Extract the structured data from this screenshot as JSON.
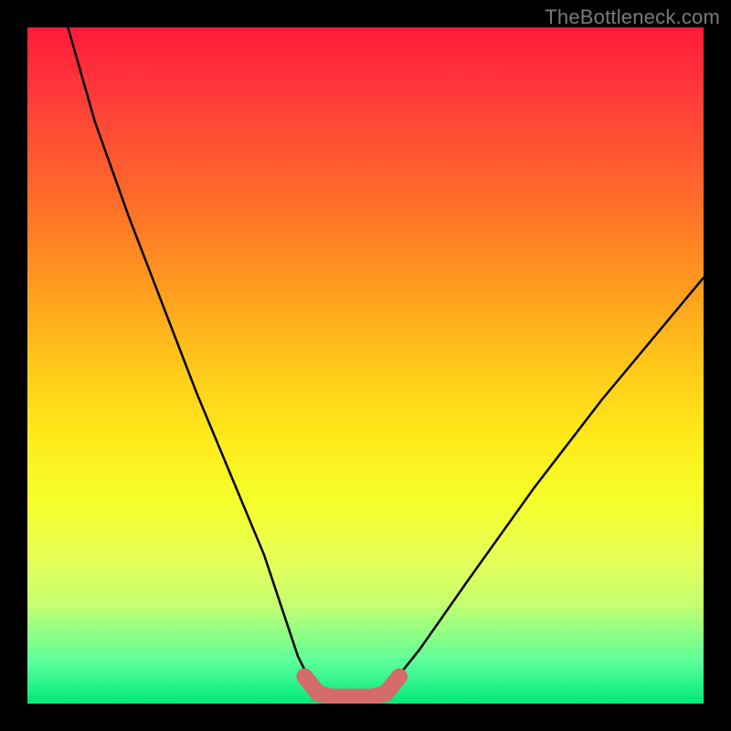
{
  "watermark": "TheBottleneck.com",
  "chart_data": {
    "type": "line",
    "title": "",
    "xlabel": "",
    "ylabel": "",
    "xlim": [
      0,
      100
    ],
    "ylim": [
      0,
      100
    ],
    "series": [
      {
        "name": "bottleneck-curve",
        "x": [
          6,
          10,
          15,
          20,
          25,
          30,
          35,
          38,
          40,
          42,
          44,
          46,
          48,
          50,
          52,
          54,
          58,
          65,
          75,
          85,
          95,
          100
        ],
        "values": [
          100,
          86,
          72,
          59,
          46,
          34,
          22,
          13,
          7,
          3,
          1.5,
          1,
          1,
          1,
          1.5,
          3,
          8,
          18,
          32,
          45,
          57,
          63
        ]
      }
    ],
    "highlight": {
      "name": "optimal-region",
      "x": [
        41,
        43,
        45,
        47,
        49,
        51,
        53,
        55
      ],
      "values": [
        4,
        1.5,
        1,
        1,
        1,
        1,
        1.5,
        4
      ],
      "color": "#d66b6b"
    }
  }
}
